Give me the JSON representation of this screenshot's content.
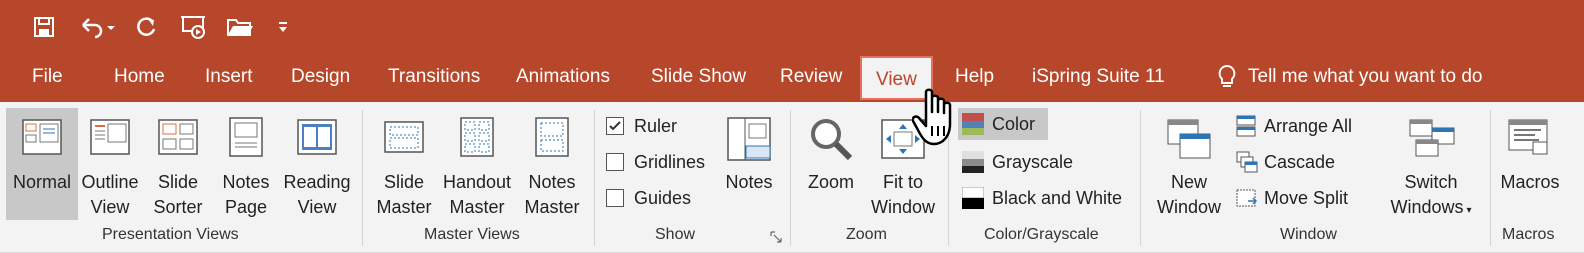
{
  "quick_access": {
    "items": [
      "save-icon",
      "undo-icon",
      "redo-icon",
      "presentation-icon",
      "open-folder-icon",
      "customize-icon"
    ]
  },
  "tabs": [
    {
      "id": "file",
      "label": "File"
    },
    {
      "id": "home",
      "label": "Home"
    },
    {
      "id": "insert",
      "label": "Insert"
    },
    {
      "id": "design",
      "label": "Design"
    },
    {
      "id": "transitions",
      "label": "Transitions"
    },
    {
      "id": "animations",
      "label": "Animations"
    },
    {
      "id": "slideshow",
      "label": "Slide Show"
    },
    {
      "id": "review",
      "label": "Review"
    },
    {
      "id": "view",
      "label": "View",
      "active": true
    },
    {
      "id": "help",
      "label": "Help"
    },
    {
      "id": "ispring",
      "label": "iSpring Suite 11"
    }
  ],
  "tell_me": "Tell me what you want to do",
  "groups": {
    "presentation_views": {
      "label": "Presentation Views",
      "buttons": [
        {
          "l1": "Normal",
          "l2": ""
        },
        {
          "l1": "Outline",
          "l2": "View"
        },
        {
          "l1": "Slide",
          "l2": "Sorter"
        },
        {
          "l1": "Notes",
          "l2": "Page"
        },
        {
          "l1": "Reading",
          "l2": "View"
        }
      ]
    },
    "master_views": {
      "label": "Master Views",
      "buttons": [
        {
          "l1": "Slide",
          "l2": "Master"
        },
        {
          "l1": "Handout",
          "l2": "Master"
        },
        {
          "l1": "Notes",
          "l2": "Master"
        }
      ]
    },
    "show": {
      "label": "Show",
      "checkboxes": [
        {
          "label": "Ruler",
          "checked": true
        },
        {
          "label": "Gridlines",
          "checked": false
        },
        {
          "label": "Guides",
          "checked": false
        }
      ],
      "notes": "Notes"
    },
    "zoom": {
      "label": "Zoom",
      "zoom": "Zoom",
      "fit_l1": "Fit to",
      "fit_l2": "Window"
    },
    "color": {
      "label": "Color/Grayscale",
      "items": [
        {
          "label": "Color",
          "selected": true
        },
        {
          "label": "Grayscale"
        },
        {
          "label": "Black and White"
        }
      ]
    },
    "window": {
      "label": "Window",
      "new_l1": "New",
      "new_l2": "Window",
      "arrange_all": "Arrange All",
      "cascade": "Cascade",
      "move_split": "Move Split",
      "switch_l1": "Switch",
      "switch_l2": "Windows"
    },
    "macros": {
      "label": "Macros",
      "macros": "Macros"
    }
  },
  "colors": {
    "accent": "#b7472a",
    "active_outline": "#e8715e"
  }
}
